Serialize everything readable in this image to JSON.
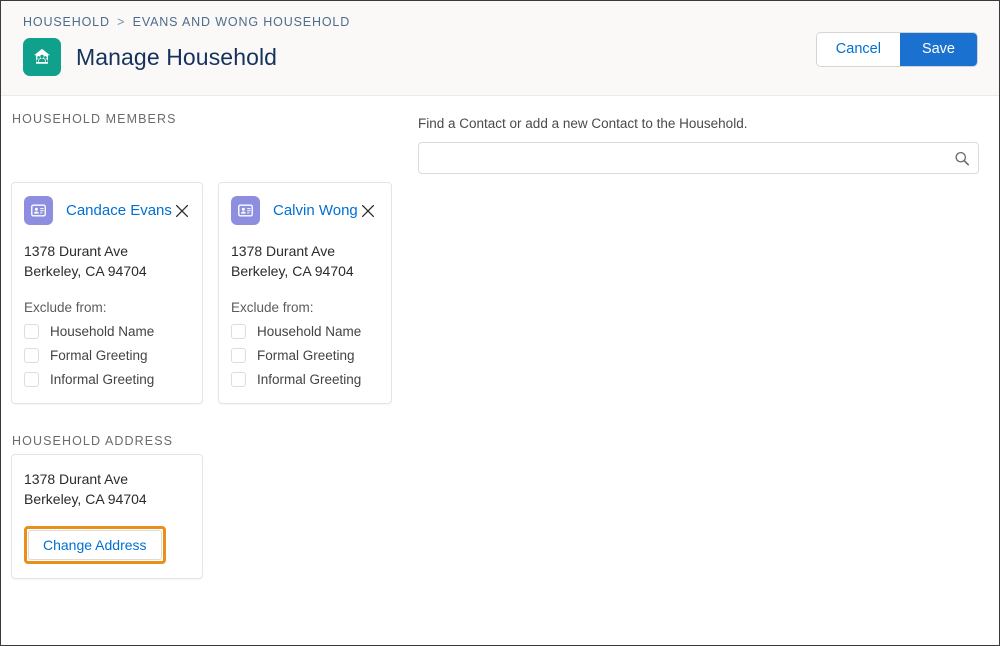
{
  "header": {
    "breadcrumb": {
      "parent": "HOUSEHOLD",
      "separator": ">",
      "current": "EVANS AND WONG HOUSEHOLD"
    },
    "title": "Manage Household",
    "app_icon": "household-icon",
    "app_icon_color": "#0FA18B",
    "cancel_label": "Cancel",
    "save_label": "Save",
    "save_color": "#1B71D0",
    "link_color": "#0070D2"
  },
  "members_section": {
    "label": "HOUSEHOLD MEMBERS",
    "exclude_label": "Exclude from:",
    "contact_icon_color": "#8E8EE0",
    "members": [
      {
        "name": "Candace Evans",
        "icon": "contact-card-icon",
        "remove_icon": "close-icon",
        "address_line1": "1378 Durant Ave",
        "address_line2": "Berkeley, CA 94704",
        "exclusions": [
          {
            "label": "Household Name",
            "checked": false
          },
          {
            "label": "Formal Greeting",
            "checked": false
          },
          {
            "label": "Informal Greeting",
            "checked": false
          }
        ]
      },
      {
        "name": "Calvin Wong",
        "icon": "contact-card-icon",
        "remove_icon": "close-icon",
        "address_line1": "1378 Durant Ave",
        "address_line2": "Berkeley, CA 94704",
        "exclusions": [
          {
            "label": "Household Name",
            "checked": false
          },
          {
            "label": "Formal Greeting",
            "checked": false
          },
          {
            "label": "Informal Greeting",
            "checked": false
          }
        ]
      }
    ]
  },
  "address_section": {
    "label": "HOUSEHOLD ADDRESS",
    "address_line1": "1378 Durant Ave",
    "address_line2": "Berkeley, CA 94704",
    "change_address_label": "Change Address",
    "highlight_color": "#E8901A"
  },
  "search": {
    "label": "Find a Contact or add a new Contact to the Household.",
    "value": "",
    "placeholder": "",
    "icon": "search-icon"
  }
}
